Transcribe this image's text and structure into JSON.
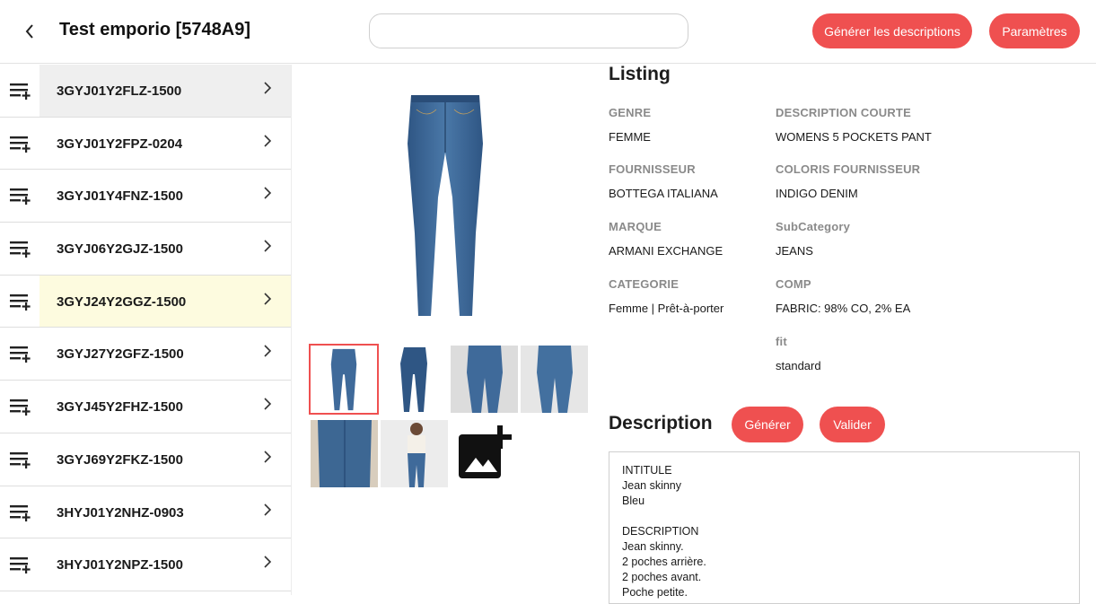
{
  "header": {
    "title": "Test emporio [5748A9]",
    "search_placeholder": "",
    "generate_descriptions_label": "Générer les descriptions",
    "settings_label": "Paramètres"
  },
  "sidebar": {
    "items": [
      {
        "sku": "3GYJ01Y2FLZ-1500"
      },
      {
        "sku": "3GYJ01Y2FPZ-0204"
      },
      {
        "sku": "3GYJ01Y4FNZ-1500"
      },
      {
        "sku": "3GYJ06Y2GJZ-1500"
      },
      {
        "sku": "3GYJ24Y2GGZ-1500"
      },
      {
        "sku": "3GYJ27Y2GFZ-1500"
      },
      {
        "sku": "3GYJ45Y2FHZ-1500"
      },
      {
        "sku": "3GYJ69Y2FKZ-1500"
      },
      {
        "sku": "3HYJ01Y2NHZ-0903"
      },
      {
        "sku": "3HYJ01Y2NPZ-1500"
      }
    ]
  },
  "listing": {
    "title": "Listing",
    "genre_label": "GENRE",
    "genre_value": "FEMME",
    "desc_courte_label": "DESCRIPTION COURTE",
    "desc_courte_value": "WOMENS 5 POCKETS PANT",
    "fournisseur_label": "FOURNISSEUR",
    "fournisseur_value": "BOTTEGA ITALIANA",
    "coloris_label": "COLORIS FOURNISSEUR",
    "coloris_value": "INDIGO DENIM",
    "marque_label": "MARQUE",
    "marque_value": "ARMANI EXCHANGE",
    "subcategory_label": "SubCategory",
    "subcategory_value": "JEANS",
    "categorie_label": "CATEGORIE",
    "categorie_value": "Femme | Prêt-à-porter",
    "comp_label": "COMP",
    "comp_value": "FABRIC: 98% CO, 2% EA",
    "fit_label": "fit",
    "fit_value": "standard"
  },
  "description": {
    "title": "Description",
    "generate_label": "Générer",
    "validate_label": "Valider",
    "text": "INTITULE\nJean skinny\nBleu\n\nDESCRIPTION\nJean skinny.\n2 poches arrière.\n2 poches avant.\nPoche petite."
  },
  "colors": {
    "accent": "#ef5050",
    "selected_row": "#efefef",
    "highlight_row": "#fdfbdf",
    "denim": "#3f6a9a"
  },
  "icons": {
    "back": "chevron-left-icon",
    "row_queue": "playlist-add-icon",
    "row_chevron": "chevron-right-icon",
    "add_photo": "add-photo-icon"
  }
}
